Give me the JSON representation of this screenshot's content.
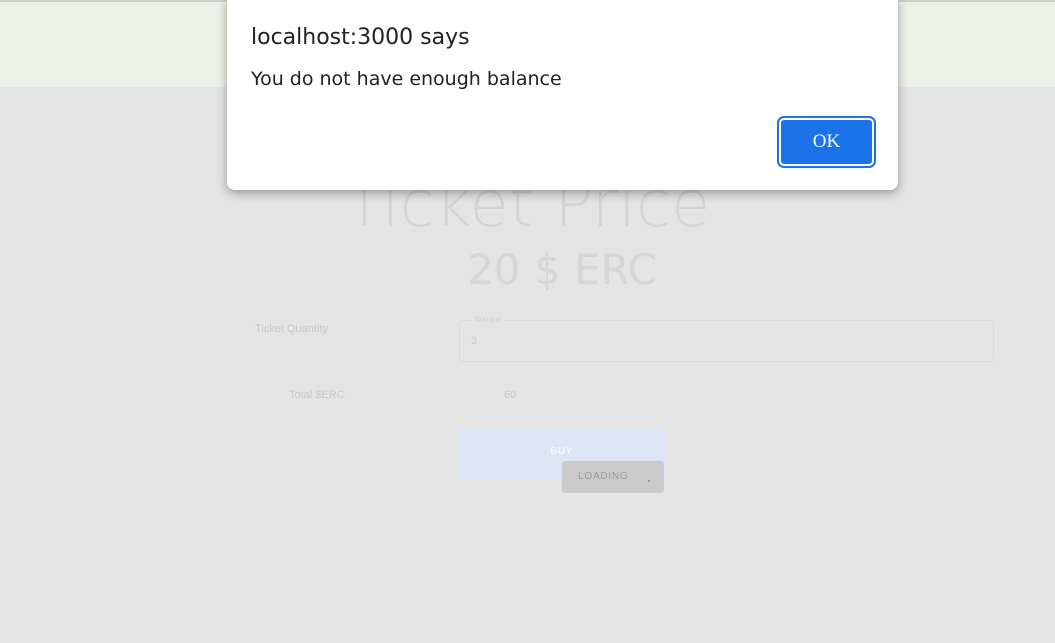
{
  "page": {
    "price_title": "Ticket Price",
    "price_value": "20 $ ERC",
    "quantity_label": "Ticket Quantity",
    "quantity_field_label": "Number",
    "quantity_value": "3",
    "total_label": "Total $ERC",
    "total_value": "60",
    "buy_label": "BUY",
    "loading_label": "LOADING"
  },
  "dialog": {
    "title": "localhost:3000 says",
    "message": "You do not have enough balance",
    "ok_label": "OK"
  },
  "colors": {
    "ok_button": "#1a73e8",
    "top_band": "#edf2e7",
    "overlay": "#e4e4e4"
  }
}
